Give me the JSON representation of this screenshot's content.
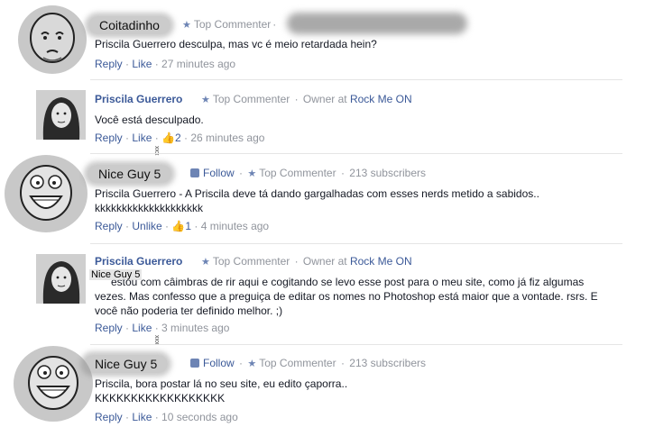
{
  "comments": [
    {
      "name": "Coitadinho",
      "badge": "Top Commenter",
      "text": "Priscila Guerrero desculpa, mas vc é meio retardada hein?",
      "reply": "Reply",
      "like": "Like",
      "time": "27 minutes ago"
    },
    {
      "name": "Priscila Guerrero",
      "badge": "Top Commenter",
      "owner_prefix": "Owner at",
      "owner_page": "Rock Me ON",
      "text": "Você está desculpado.",
      "reply": "Reply",
      "like": "Like",
      "likes_count": "2",
      "time": "26 minutes ago"
    },
    {
      "name": "Nice Guy 5",
      "follow": "Follow",
      "badge": "Top Commenter",
      "subscribers": "213 subscribers",
      "text": "Priscila Guerrero - A Priscila deve tá dando gargalhadas com esses nerds metido a sabidos.. kkkkkkkkkkkkkkkkkkkk",
      "reply": "Reply",
      "like": "Unlike",
      "likes_count": "1",
      "time": "4 minutes ago"
    },
    {
      "name": "Priscila Guerrero",
      "badge": "Top Commenter",
      "owner_prefix": "Owner at",
      "owner_page": "Rock Me ON",
      "overlay": "Nice Guy 5",
      "text": "estou com câimbras de rir aqui e cogitando se levo esse post para o meu site, como já fiz algumas vezes. Mas confesso que a preguiça de editar os nomes no Photoshop está maior que a vontade. rsrs. E você não poderia ter definido melhor. ;)",
      "reply": "Reply",
      "like": "Like",
      "time": "3 minutes ago"
    },
    {
      "name": "Nice Guy 5",
      "follow": "Follow",
      "badge": "Top Commenter",
      "subscribers": "213 subscribers",
      "text": "Priscila, bora postar lá no seu site, eu edito çaporra..\nKKKKKKKKKKKKKKKKKK",
      "reply": "Reply",
      "like": "Like",
      "time": "10 seconds ago"
    }
  ],
  "colors": {
    "link": "#3b5998",
    "meta": "#90949c",
    "text": "#141823"
  }
}
